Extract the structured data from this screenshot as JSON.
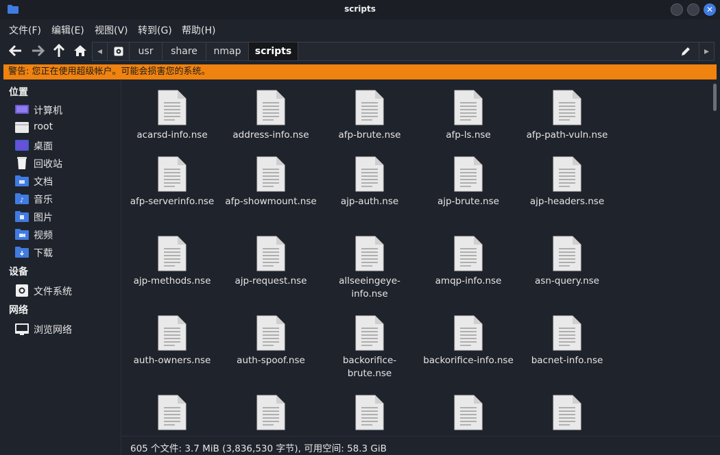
{
  "window": {
    "title": "scripts"
  },
  "menu": [
    "文件(F)",
    "编辑(E)",
    "视图(V)",
    "转到(G)",
    "帮助(H)"
  ],
  "path": [
    "usr",
    "share",
    "nmap",
    "scripts"
  ],
  "warning": "警告: 您正在使用超级帐户。可能会损害您的系统。",
  "sidebar": {
    "places_header": "位置",
    "places": [
      {
        "label": "计算机",
        "icon": "computer-icon"
      },
      {
        "label": "root",
        "icon": "home-folder-icon"
      },
      {
        "label": "桌面",
        "icon": "desktop-icon"
      },
      {
        "label": "回收站",
        "icon": "trash-icon"
      },
      {
        "label": "文档",
        "icon": "documents-folder-icon"
      },
      {
        "label": "音乐",
        "icon": "music-folder-icon"
      },
      {
        "label": "图片",
        "icon": "pictures-folder-icon"
      },
      {
        "label": "视频",
        "icon": "videos-folder-icon"
      },
      {
        "label": "下载",
        "icon": "downloads-folder-icon"
      }
    ],
    "devices_header": "设备",
    "devices": [
      {
        "label": "文件系统",
        "icon": "drive-icon"
      }
    ],
    "network_header": "网络",
    "network": [
      {
        "label": "浏览网络",
        "icon": "network-icon"
      }
    ]
  },
  "files": [
    [
      "acarsd-info.nse",
      "address-info.nse",
      "afp-brute.nse",
      "afp-ls.nse",
      "afp-path-vuln.nse"
    ],
    [
      "afp-serverinfo.nse",
      "afp-showmount.nse",
      "ajp-auth.nse",
      "ajp-brute.nse",
      "ajp-headers.nse"
    ],
    [
      "ajp-methods.nse",
      "ajp-request.nse",
      "allseeingeye-info.nse",
      "amqp-info.nse",
      "asn-query.nse"
    ],
    [
      "auth-owners.nse",
      "auth-spoof.nse",
      "backorifice-brute.nse",
      "backorifice-info.nse",
      "bacnet-info.nse"
    ],
    [
      "",
      "",
      "",
      "",
      ""
    ]
  ],
  "file_display_names": [
    [
      "acarsd-info.nse",
      "address-info.nse",
      "afp-brute.nse",
      "afp-ls.nse",
      "afp-path-vuln.nse"
    ],
    [
      "afp-serverinfo.nse",
      "afp-showmount.nse",
      "ajp-auth.nse",
      "ajp-brute.nse",
      "ajp-headers.nse"
    ],
    [
      "ajp-methods.nse",
      "ajp-request.nse",
      "allseeingeye-\ninfo.nse",
      "amqp-info.nse",
      "asn-query.nse"
    ],
    [
      "auth-owners.nse",
      "auth-spoof.nse",
      "backorifice-\nbrute.nse",
      "backorifice-info.nse",
      "bacnet-info.nse"
    ]
  ],
  "status": "605 个文件: 3.7 MiB (3,836,530 字节), 可用空间: 58.3 GiB",
  "colors": {
    "warning_bg": "#f0830f",
    "folder_blue": "#3f7be0"
  }
}
